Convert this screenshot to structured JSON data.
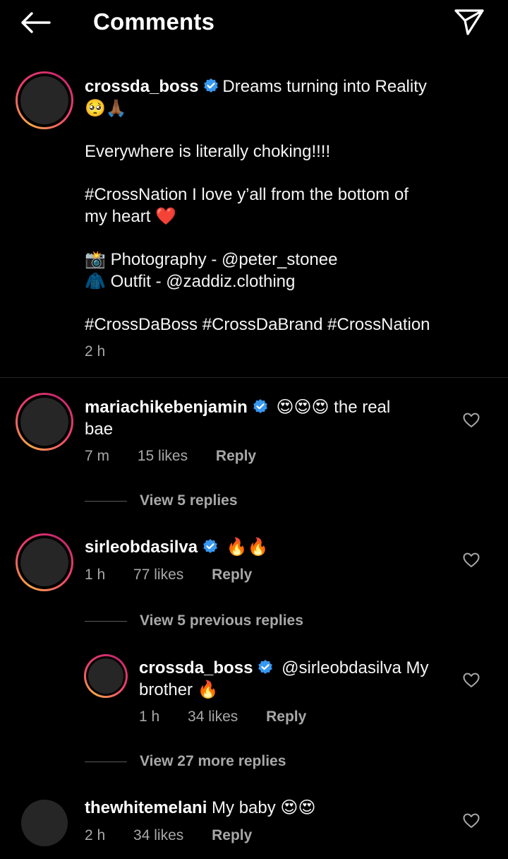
{
  "header": {
    "title": "Comments"
  },
  "caption": {
    "username": "crossda_boss",
    "line1": "Dreams turning into Reality",
    "line1_emoji": "🥺🙏🏾",
    "line2": "Everywhere is literally choking!!!!",
    "line3": "#CrossNation I love y’all from the bottom of",
    "line4": "my heart",
    "line4_emoji": "❤️",
    "photo_emoji": "📸",
    "photo_text": "Photography - @peter_stonee",
    "outfit_emoji": "🧥",
    "outfit_text": "Outfit - @zaddiz.clothing",
    "hashtags": "#CrossDaBoss #CrossDaBrand #CrossNation",
    "time": "2 h"
  },
  "comments": [
    {
      "username": "mariachikebenjamin",
      "emoji": "😍😍😍",
      "text_after": "the real",
      "text_line2": "bae",
      "time": "7 m",
      "likes": "15 likes",
      "reply": "Reply",
      "view_replies": "View 5 replies"
    },
    {
      "username": "sirleobdasilva",
      "emoji": "🔥🔥",
      "time": "1 h",
      "likes": "77 likes",
      "reply": "Reply",
      "view_replies": "View 5 previous replies"
    },
    {
      "username": "crossda_boss",
      "text": "@sirleobdasilva My",
      "text_line2": "brother",
      "emoji": "🔥",
      "time": "1 h",
      "likes": "34 likes",
      "reply": "Reply",
      "view_replies": "View 27 more replies"
    },
    {
      "username": "thewhitemelani",
      "text": "My baby",
      "emoji": "😍😍",
      "time": "2 h",
      "likes": "34 likes",
      "reply": "Reply"
    }
  ],
  "colors": {
    "background": "#000000",
    "text": "#f5f5f5",
    "muted": "#a8a8a8",
    "verified": "#3897f0",
    "heart": "#ed2e3a"
  }
}
